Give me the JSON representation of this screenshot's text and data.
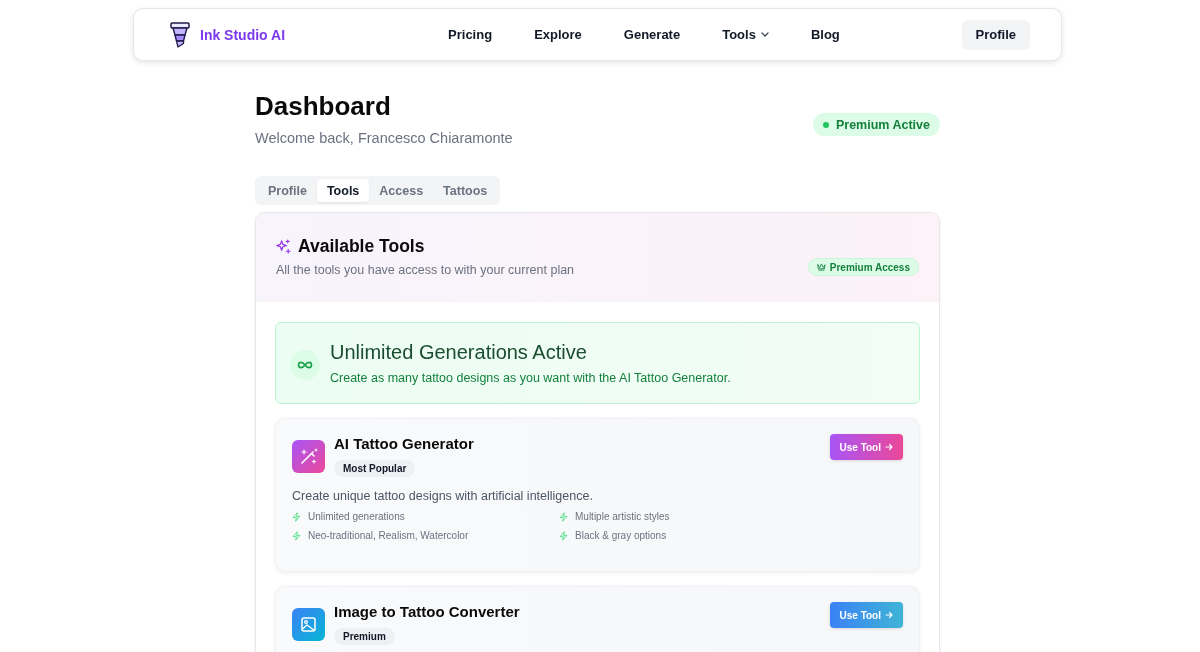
{
  "nav": {
    "brand": "Ink Studio AI",
    "links": [
      {
        "label": "Pricing",
        "dropdown": false
      },
      {
        "label": "Explore",
        "dropdown": false
      },
      {
        "label": "Generate",
        "dropdown": false
      },
      {
        "label": "Tools",
        "dropdown": true
      },
      {
        "label": "Blog",
        "dropdown": false
      }
    ],
    "profile_button": "Profile"
  },
  "header": {
    "title": "Dashboard",
    "subtitle": "Welcome back, Francesco Chiaramonte",
    "status_badge": "Premium Active"
  },
  "tabs": [
    {
      "label": "Profile",
      "selected": false
    },
    {
      "label": "Tools",
      "selected": true
    },
    {
      "label": "Access",
      "selected": false
    },
    {
      "label": "Tattoos",
      "selected": false
    }
  ],
  "tools_panel": {
    "title": "Available Tools",
    "subtitle": "All the tools you have access to with your current plan",
    "badge": "Premium Access",
    "banner": {
      "title": "Unlimited Generations Active",
      "text": "Create as many tattoo designs as you want with the AI Tattoo Generator."
    },
    "tools": [
      {
        "kind": "generator",
        "name": "AI Tattoo Generator",
        "badge": "Most Popular",
        "button": "Use Tool",
        "description": "Create unique tattoo designs with artificial intelligence.",
        "features": [
          "Unlimited generations",
          "Multiple artistic styles",
          "Neo-traditional, Realism, Watercolor",
          "Black & gray options"
        ]
      },
      {
        "kind": "converter",
        "name": "Image to Tattoo Converter",
        "badge": "Premium",
        "button": "Use Tool"
      }
    ]
  }
}
